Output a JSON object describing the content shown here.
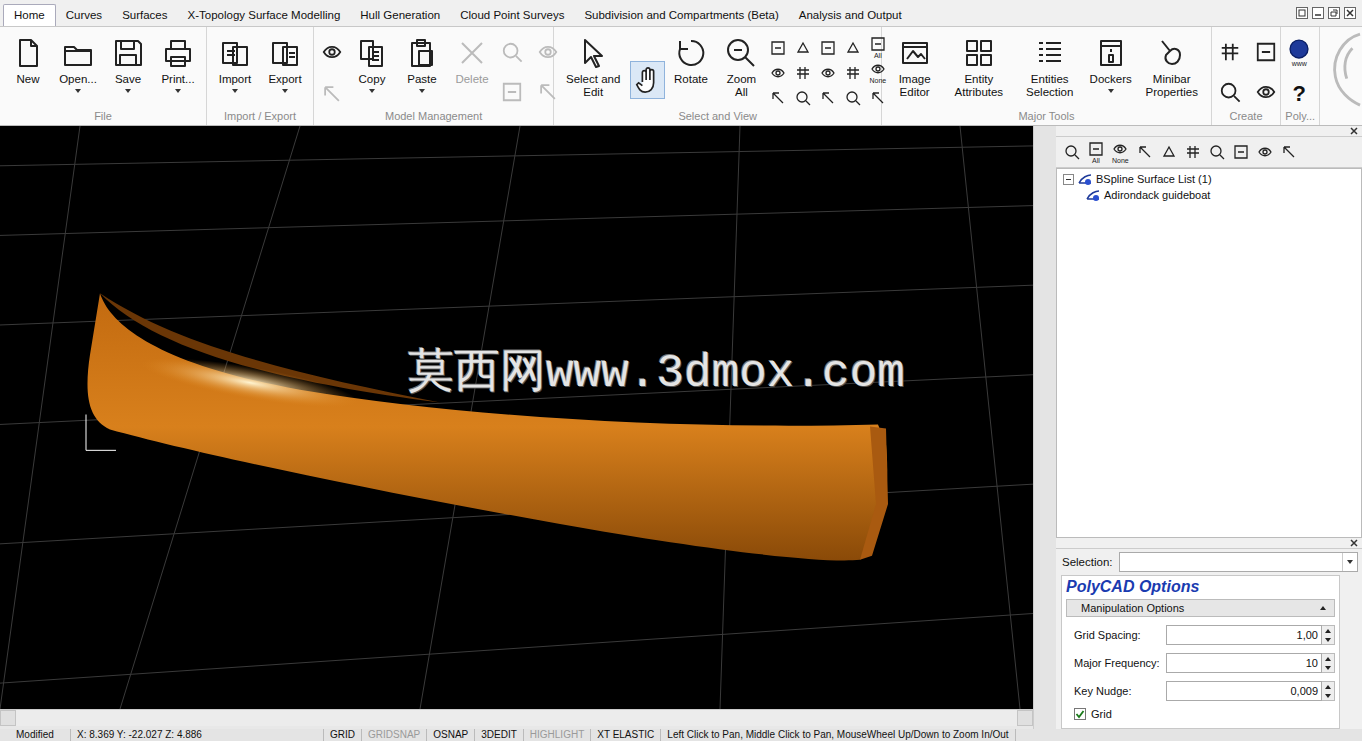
{
  "window": {
    "tabs": [
      {
        "label": "Home",
        "selected": true
      },
      {
        "label": "Curves",
        "selected": false
      },
      {
        "label": "Surfaces",
        "selected": false
      },
      {
        "label": "X-Topology Surface Modelling",
        "selected": false
      },
      {
        "label": "Hull Generation",
        "selected": false
      },
      {
        "label": "Cloud Point Surveys",
        "selected": false
      },
      {
        "label": "Subdivision and Compartments (Beta)",
        "selected": false
      },
      {
        "label": "Analysis and Output",
        "selected": false
      }
    ]
  },
  "ribbon": {
    "groups": [
      {
        "label": "File",
        "items": [
          {
            "kind": "large",
            "label": "New",
            "dropdown": false,
            "disabled": false
          },
          {
            "kind": "large",
            "label": "Open...",
            "dropdown": true,
            "disabled": false
          },
          {
            "kind": "large",
            "label": "Save",
            "dropdown": true,
            "disabled": false
          },
          {
            "kind": "large",
            "label": "Print...",
            "dropdown": true,
            "disabled": false
          }
        ]
      },
      {
        "label": "Import / Export",
        "items": [
          {
            "kind": "large",
            "label": "Import",
            "dropdown": true,
            "disabled": false
          },
          {
            "kind": "large",
            "label": "Export",
            "dropdown": true,
            "disabled": false
          }
        ]
      },
      {
        "label": "Model Management",
        "items": [
          {
            "kind": "stack",
            "buttons": [
              {
                "glyph": "",
                "sub": "",
                "disabled": false
              },
              {
                "glyph": "",
                "sub": "",
                "disabled": true
              }
            ]
          },
          {
            "kind": "large",
            "label": "Copy",
            "dropdown": true,
            "disabled": false
          },
          {
            "kind": "large",
            "label": "Paste",
            "dropdown": true,
            "disabled": false
          },
          {
            "kind": "large",
            "label": "Delete",
            "dropdown": false,
            "disabled": true
          },
          {
            "kind": "grid2",
            "buttons": [
              {
                "glyph": "",
                "sub": "",
                "disabled": true
              },
              {
                "glyph": "",
                "sub": "",
                "disabled": true
              },
              {
                "glyph": "",
                "sub": "",
                "disabled": true
              },
              {
                "glyph": "",
                "sub": "",
                "disabled": true
              }
            ]
          }
        ]
      },
      {
        "label": "Select and View",
        "items": [
          {
            "kind": "large",
            "label": "Select and Edit",
            "dropdown": false,
            "disabled": false
          },
          {
            "kind": "toggle",
            "selected": true
          },
          {
            "kind": "large",
            "label": "Rotate",
            "dropdown": false,
            "disabled": false
          },
          {
            "kind": "large",
            "label": "Zoom All",
            "dropdown": false,
            "disabled": false
          },
          {
            "kind": "grid3",
            "buttons": [
              {
                "glyph": "",
                "sub": "",
                "disabled": false
              },
              {
                "glyph": "",
                "sub": "",
                "disabled": false
              },
              {
                "glyph": "",
                "sub": "",
                "disabled": false
              },
              {
                "glyph": "",
                "sub": "",
                "disabled": false
              },
              {
                "glyph": "",
                "sub": "",
                "disabled": false
              },
              {
                "glyph": "",
                "sub": "",
                "disabled": false
              },
              {
                "glyph": "",
                "sub": "",
                "disabled": false
              },
              {
                "glyph": "",
                "sub": "",
                "disabled": false
              },
              {
                "glyph": "",
                "sub": "",
                "disabled": false
              },
              {
                "glyph": "",
                "sub": "",
                "disabled": false
              },
              {
                "glyph": "",
                "sub": "",
                "disabled": false
              },
              {
                "glyph": "",
                "sub": "",
                "disabled": false
              },
              {
                "glyph": "",
                "sub": "All",
                "disabled": false
              },
              {
                "glyph": "",
                "sub": "None",
                "disabled": false
              },
              {
                "glyph": "",
                "sub": "",
                "disabled": false
              }
            ]
          }
        ]
      },
      {
        "label": "Major Tools",
        "items": [
          {
            "kind": "large",
            "label": "Image Editor",
            "dropdown": false,
            "disabled": false
          },
          {
            "kind": "large",
            "label": "Entity Attributes",
            "dropdown": false,
            "disabled": false
          },
          {
            "kind": "large",
            "label": "Entities Selection",
            "dropdown": false,
            "disabled": false
          },
          {
            "kind": "large",
            "label": "Dockers",
            "dropdown": true,
            "disabled": false
          },
          {
            "kind": "large",
            "label": "Minibar Properties",
            "dropdown": false,
            "disabled": false
          }
        ]
      },
      {
        "label": "Create",
        "items": [
          {
            "kind": "grid2",
            "buttons": [
              {
                "glyph": "",
                "sub": "",
                "disabled": false
              },
              {
                "glyph": "",
                "sub": "",
                "disabled": false
              },
              {
                "glyph": "",
                "sub": "",
                "disabled": false
              },
              {
                "glyph": "",
                "sub": "",
                "disabled": false
              }
            ]
          }
        ]
      },
      {
        "label": "Poly...",
        "items": [
          {
            "kind": "stack",
            "buttons": [
              {
                "glyph": "",
                "sub": "www",
                "disabled": false
              },
              {
                "glyph": "?",
                "sub": "",
                "disabled": false
              }
            ]
          }
        ]
      }
    ]
  },
  "viewport": {
    "watermark": "莫西网www.3dmox.com"
  },
  "panel": {
    "toolbar": [
      {
        "sub": ""
      },
      {
        "sub": "All"
      },
      {
        "sub": "None"
      },
      {
        "sub": ""
      },
      {
        "sub": ""
      },
      {
        "sub": ""
      },
      {
        "sub": ""
      },
      {
        "sub": ""
      },
      {
        "sub": ""
      },
      {
        "sub": ""
      }
    ],
    "tree": [
      {
        "label": "BSpline Surface List (1)",
        "depth": 0,
        "expanded": true,
        "selected": false
      },
      {
        "label": "Adirondack guideboat",
        "depth": 1,
        "expanded": false,
        "selected": false
      }
    ],
    "selection": {
      "label": "Selection:",
      "value": ""
    },
    "options": {
      "title": "PolyCAD Options",
      "section": {
        "label": "Manipulation Options",
        "expanded": true
      },
      "fields": [
        {
          "label": "Grid Spacing:",
          "value": "1,00"
        },
        {
          "label": "Major Frequency:",
          "value": "10"
        },
        {
          "label": "Key Nudge:",
          "value": "0,009"
        }
      ],
      "checkboxes": [
        {
          "label": "Grid",
          "checked": true
        }
      ]
    }
  },
  "status_bar": [
    {
      "text": "Modified",
      "disabled": false
    },
    {
      "text": "X:  8.369  Y: -22.027  Z:  4.886",
      "disabled": false
    },
    {
      "text": "GRID",
      "disabled": false
    },
    {
      "text": "GRIDSNAP",
      "disabled": true
    },
    {
      "text": "OSNAP",
      "disabled": false
    },
    {
      "text": "3DEDIT",
      "disabled": false
    },
    {
      "text": "HIGHLIGHT",
      "disabled": true
    },
    {
      "text": "XT ELASTIC",
      "disabled": false
    },
    {
      "text": "Left Click to Pan, Middle Click to Pan, MouseWheel Up/Down to Zoom In/Out",
      "disabled": false
    }
  ]
}
